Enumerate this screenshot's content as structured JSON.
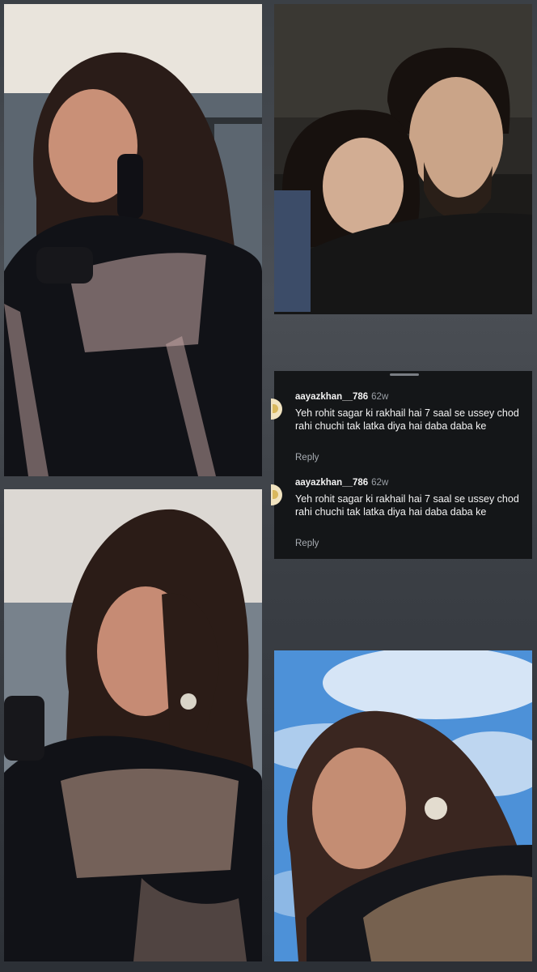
{
  "collage": {
    "photos": [
      {
        "name": "photo-woman-black-suit-profile",
        "palette": {
          "sky": "#e9e4dc",
          "wall": "#5c6670",
          "hair": "#2a1c18",
          "skin": "#c99077",
          "outfit": "#111217",
          "embroidery": "#c9a9a8"
        }
      },
      {
        "name": "photo-couple-night",
        "palette": {
          "bg": "#2b2926",
          "hair": "#17110e",
          "skin": "#caa488",
          "outfit": "#161616"
        }
      },
      {
        "name": "photo-woman-looking-side",
        "palette": {
          "sky": "#dcd8d3",
          "wall": "#78828c",
          "hair": "#2b1c17",
          "skin": "#c68b74",
          "outfit": "#111217",
          "embroidery": "#c7a38f"
        }
      },
      {
        "name": "photo-woman-selfie-blue-sky",
        "palette": {
          "sky": "#4d91d8",
          "cloud": "#eef3fb",
          "hair": "#3a2620",
          "skin": "#c48d73",
          "outfit": "#15161b",
          "embroidery": "#c7a07a"
        }
      }
    ]
  },
  "comments": [
    {
      "username": "aayazkhan__786",
      "time": "62w",
      "text": "Yeh rohit sagar ki rakhail hai 7 saal se ussey chod rahi chuchi tak latka diya hai daba daba ke",
      "reply_label": "Reply"
    },
    {
      "username": "aayazkhan__786",
      "time": "62w",
      "text": "Yeh rohit sagar ki rakhail hai 7 saal se ussey chod rahi chuchi tak latka diya hai daba daba ke",
      "reply_label": "Reply"
    }
  ]
}
